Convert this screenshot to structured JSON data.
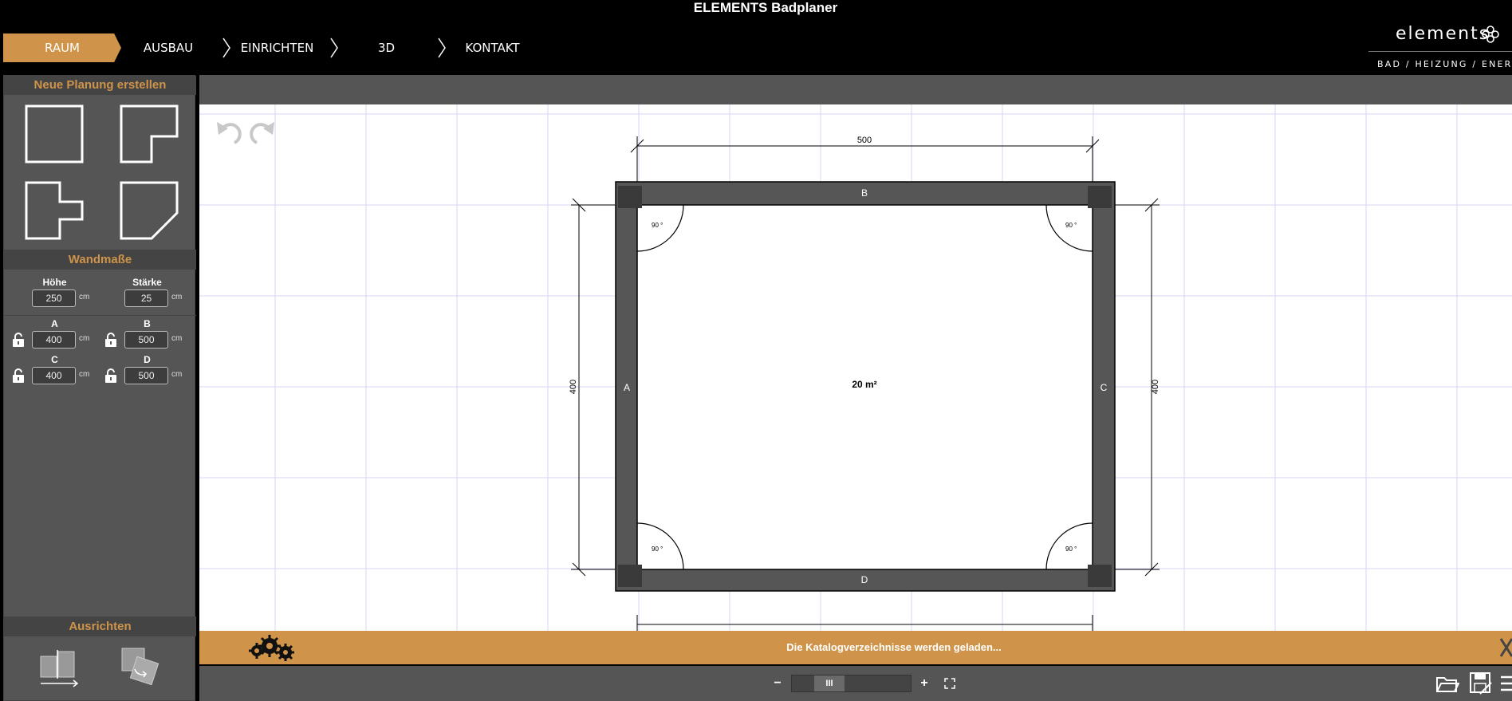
{
  "app": {
    "title": "ELEMENTS Badplaner"
  },
  "nav": {
    "items": [
      {
        "label": "RAUM",
        "active": true
      },
      {
        "label": "AUSBAU",
        "active": false
      },
      {
        "label": "EINRICHTEN",
        "active": false
      },
      {
        "label": "3D",
        "active": false
      },
      {
        "label": "KONTAKT",
        "active": false
      }
    ]
  },
  "brand": {
    "name": "elements",
    "tagline": "BAD / HEIZUNG / ENERGIE"
  },
  "sidebar": {
    "new_plan": {
      "title": "Neue Planung erstellen",
      "shapes": [
        "rectangle-room-icon",
        "l-shape-room-icon",
        "t-shape-room-icon",
        "angled-corner-room-icon"
      ]
    },
    "walls": {
      "title": "Wandmaße",
      "height_label": "Höhe",
      "height_value": "250",
      "thickness_label": "Stärke",
      "thickness_value": "25",
      "unit": "cm",
      "sides": [
        {
          "label": "A",
          "value": "400"
        },
        {
          "label": "B",
          "value": "500"
        },
        {
          "label": "C",
          "value": "400"
        },
        {
          "label": "D",
          "value": "500"
        }
      ]
    },
    "align": {
      "title": "Ausrichten"
    }
  },
  "plan": {
    "dimension_top": "500",
    "dimension_left": "400",
    "dimension_right": "400",
    "wall_labels": {
      "top": "B",
      "bottom": "D",
      "left": "A",
      "right": "C"
    },
    "area": "20 m²",
    "corner_angle": "90 °"
  },
  "status": {
    "message": "Die Katalogverzeichnisse werden geladen..."
  },
  "zoom": {
    "minus": "−",
    "plus": "+",
    "thumb": "III"
  },
  "colors": {
    "accent": "#cf9449",
    "panel": "#555555",
    "wall": "#565656",
    "grid": "#d6d6f2"
  }
}
